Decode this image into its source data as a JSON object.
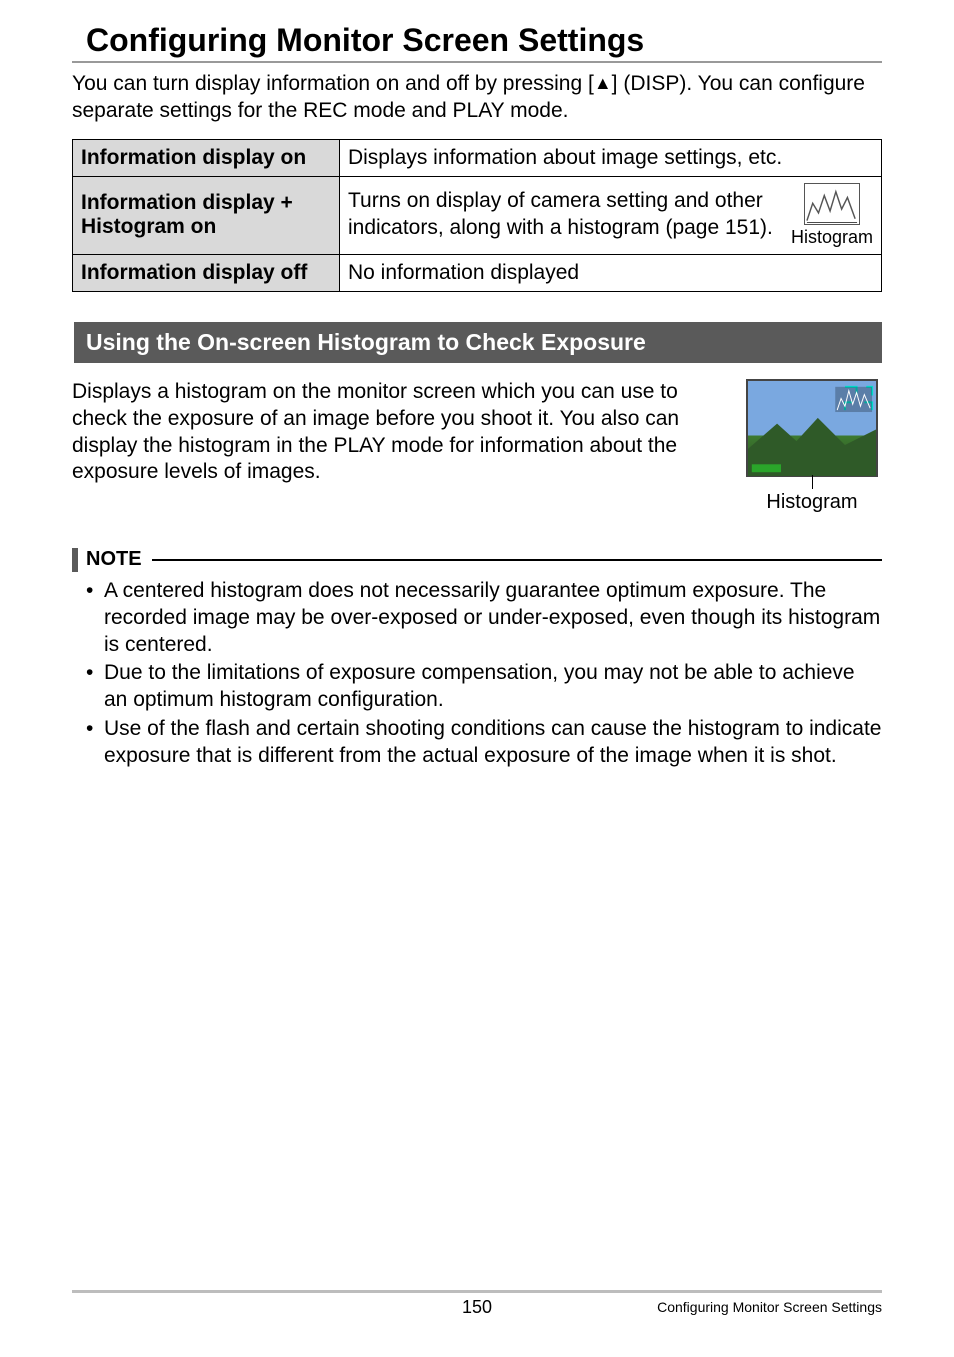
{
  "title": "Configuring Monitor Screen Settings",
  "intro_pre": "You can turn display information on and off by pressing [",
  "intro_post": "] (DISP). You can configure separate settings for the REC mode and PLAY mode.",
  "table": {
    "row1": {
      "label": "Information display on",
      "desc": "Displays information about image settings, etc."
    },
    "row2": {
      "label": "Information display + Histogram on",
      "desc": "Turns on display of camera setting and other indicators, along with a histogram (page 151).",
      "icon_caption": "Histogram"
    },
    "row3": {
      "label": "Information display off",
      "desc": "No information displayed"
    }
  },
  "section_heading": "Using the On-screen Histogram to Check Exposure",
  "section_body": "Displays a histogram on the monitor screen which you can use to check the exposure of an image before you shoot it. You also can display the histogram in the PLAY mode for information about the exposure levels of images.",
  "histogram_caption": "Histogram",
  "note_label": "NOTE",
  "notes": [
    "A centered histogram does not necessarily guarantee optimum exposure. The recorded image may be over-exposed or under-exposed, even though its histogram is centered.",
    "Due to the limitations of exposure compensation, you may not be able to achieve an optimum histogram configuration.",
    "Use of the flash and certain shooting conditions can cause the histogram to indicate exposure that is different from the actual exposure of the image when it is shot."
  ],
  "footer": {
    "page_number": "150",
    "section": "Configuring Monitor Screen Settings"
  }
}
